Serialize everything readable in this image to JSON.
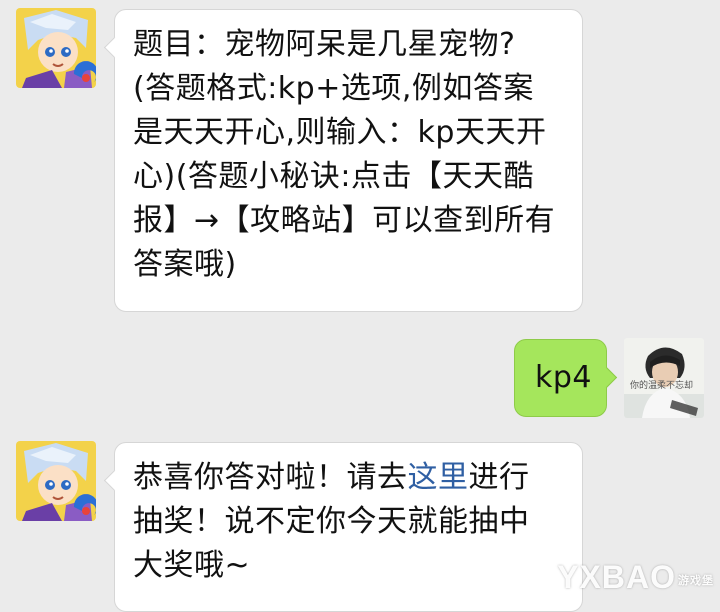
{
  "chat": {
    "messages": [
      {
        "sender": "bot",
        "lines": [
          "题目：宠物阿呆是几星宠物?",
          "(答题格式:kp+选项,例如答案",
          "是天天开心,则输入：kp天天开",
          "心)(答题小秘诀:点击【天天酷",
          "报】→【攻略站】可以查到所有",
          "答案哦)"
        ]
      },
      {
        "sender": "user",
        "text": "kp4",
        "avatar_caption": "你的温柔不忘却"
      },
      {
        "sender": "bot",
        "line1_before": "恭喜你答对啦！请去",
        "link_text": "这里",
        "line1_after": "进行",
        "line2": "抽奖！说不定你今天就能抽中",
        "line3": "大奖哦~"
      }
    ]
  },
  "watermark": {
    "text": "YXBAO",
    "sub": "游戏堡"
  },
  "colors": {
    "background": "#ebebeb",
    "incoming_bubble": "#ffffff",
    "outgoing_bubble": "#a5e65c",
    "link": "#2f5fa3"
  }
}
